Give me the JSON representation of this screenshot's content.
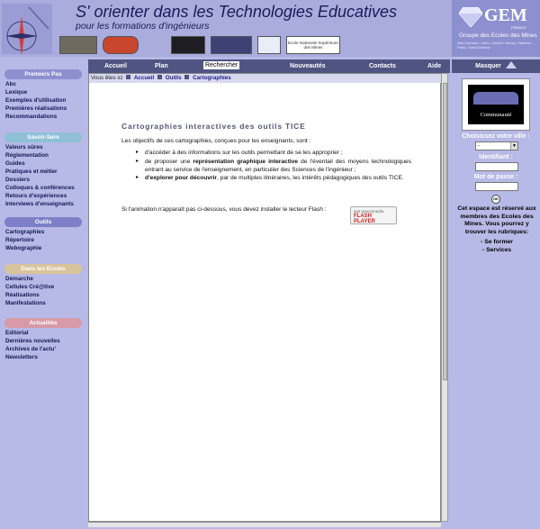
{
  "header": {
    "title": "S' orienter dans les Technologies Educatives",
    "subtitle": "pour les formations d'ingénieurs",
    "gem_brand": "GEM",
    "gem_country": "FRANCE",
    "gem_subtitle": "Groupe des Ecoles des Mines",
    "gem_schools": "Albi-Carmaux • Alès • Douai • Nancy • Nantes • Paris • Saint-Etienne",
    "partner_logo_text": "Ecole Nationale Supérieure des Mines"
  },
  "sidebar": {
    "sections": [
      {
        "title": "Premiers Pas",
        "color": "#8d90cf",
        "links": [
          "Abc",
          "Lexique",
          "Exemples d'utilisation",
          "Premières réalisations",
          "Recommandations"
        ]
      },
      {
        "title": "Savoir-faire",
        "color": "#8fc0d6",
        "links": [
          "Valeurs sûres",
          "Réglementation",
          "Guides",
          "Pratiques et métier",
          "Dossiers",
          "Colloques & conférences",
          "Retours d'expériences",
          "Interviews d'enseignants"
        ]
      },
      {
        "title": "Outils",
        "color": "#7d80c6",
        "links": [
          "Cartographies",
          "Répertoire",
          "Webographie"
        ]
      },
      {
        "title": "Dans les Ecoles",
        "color": "#d9c39a",
        "links": [
          "Démarche",
          "Cellules Cré@tive",
          "Réalisations",
          "Manifestations"
        ]
      },
      {
        "title": "Actualités",
        "color": "#d89aa8",
        "links": [
          "Editorial",
          "Dernières nouvelles",
          "Archives de l'actu'",
          "Newsletters"
        ]
      }
    ]
  },
  "nav": {
    "accueil": "Accueil",
    "plan": "Plan",
    "rechercher": "Rechercher",
    "nouveautes": "Nouveautés",
    "contacts": "Contacts",
    "aide": "Aide"
  },
  "breadcrumb": {
    "prefix": "Vous êtes ici",
    "items": [
      "Accueil",
      "Outils",
      "Cartographies"
    ]
  },
  "article": {
    "title": "Cartographies interactives des outils TICE",
    "intro": "Les objectifs de ces cartographies, conçues pour les enseignants, sont :",
    "bullet1": "d'accéder à des informations sur les outils permettant de se les approprier ;",
    "bullet2_pre": "de proposer une ",
    "bullet2_bold": "représentation graphique interactive",
    "bullet2_post": " de l'éventail des moyens technologiques entrant au service de l'enseignement, en particulier des Sciences de l'ingénieur ;",
    "bullet3_bold": "d'explorer pour découvrir",
    "bullet3_post": ", par de multiples itinéraires, les intérêts pédagogiques des outils TICE.",
    "flash_text": "Si l'animation n'apparaît pas ci-dessous, vous devez installer le lecteur Flash :",
    "flash_badge_top": "Get macromedia",
    "flash_badge_main": "FLASH",
    "flash_badge_sub": "PLAYER"
  },
  "right_panel": {
    "masquer": "Masquer",
    "community_label": "Communauté",
    "choose_city": "Choisissez votre ville :",
    "city_value": "-",
    "identifiant": "Identifiant :",
    "password": "Mot de passe :",
    "ok": "OK",
    "note": "Cet espace est réservé aux membres des Ecoles des Mines. Vous pourrez y trouver les rubriques:",
    "item1": "- Se former",
    "item2": "- Services"
  }
}
